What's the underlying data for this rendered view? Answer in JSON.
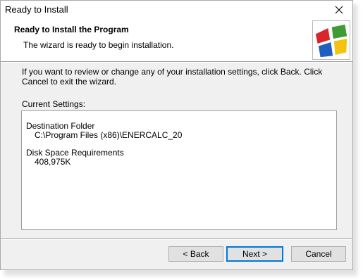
{
  "window": {
    "title": "Ready to Install",
    "close_glyph": "✕"
  },
  "header": {
    "title": "Ready to Install the Program",
    "subtitle": "The wizard is ready to begin installation.",
    "logo_icon": "installer-windows-logo-icon"
  },
  "body": {
    "description": "If you want to review or change any of your installation settings, click Back. Click Cancel to exit the wizard.",
    "current_settings_label": "Current Settings:",
    "settings": [
      {
        "label": "Destination Folder",
        "value": "C:\\Program Files (x86)\\ENERCALC_20"
      },
      {
        "label": "Disk Space Requirements",
        "value": "408,975K"
      }
    ]
  },
  "buttons": {
    "back": "< Back",
    "next": "Next >",
    "cancel": "Cancel"
  },
  "colors": {
    "accent": "#0078d7",
    "window_bg": "#f0f0f0",
    "logo_red": "#d8262c",
    "logo_green": "#3f9b35",
    "logo_blue": "#1f5fbf",
    "logo_yellow": "#f2c311"
  }
}
